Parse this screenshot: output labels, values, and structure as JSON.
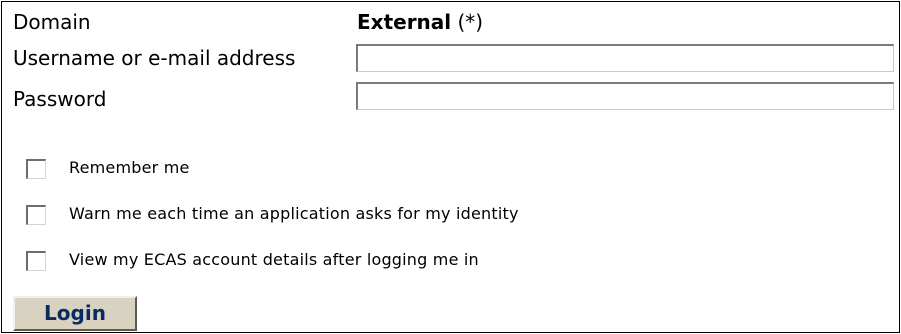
{
  "form": {
    "domain": {
      "label": "Domain",
      "value_bold": "External",
      "value_suffix": " (*)"
    },
    "username": {
      "label": "Username or e-mail address",
      "value": "",
      "placeholder": ""
    },
    "password": {
      "label": "Password",
      "value": "",
      "placeholder": ""
    },
    "options": [
      {
        "label": "Remember me",
        "checked": false
      },
      {
        "label": "Warn me each time an application asks for my identity",
        "checked": false
      },
      {
        "label": "View my ECAS account details after logging me in",
        "checked": false
      }
    ],
    "login_button": "Login"
  },
  "colors": {
    "button_bg": "#d8d2c1",
    "button_text": "#0b2a63",
    "border": "#000000"
  }
}
